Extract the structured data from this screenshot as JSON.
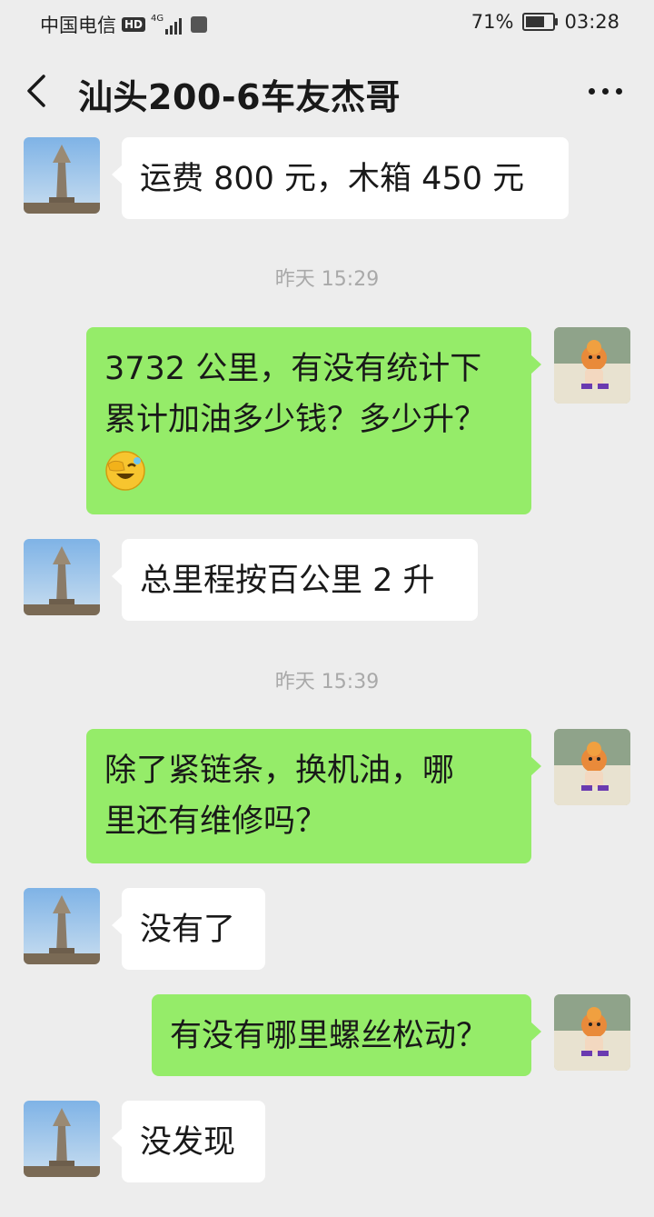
{
  "status_bar": {
    "carrier": "中国电信",
    "hd": "HD",
    "network": "4G",
    "battery_percent": "71%",
    "battery_level": 0.71,
    "time": "03:28"
  },
  "nav": {
    "back_icon": "chevron-left-icon",
    "title": "汕头200-6车友杰哥",
    "more_icon": "more-dots-icon"
  },
  "messages": [
    {
      "side": "in",
      "text": "运费 800 元，木箱 450 元"
    },
    {
      "timestamp": "昨天 15:29"
    },
    {
      "side": "out",
      "line1": "3732 公里，有没有统计下",
      "line2": "累计加油多少钱？多少升？",
      "emoji": "facepalm-laugh-emoji"
    },
    {
      "side": "in",
      "text": "总里程按百公里 2 升"
    },
    {
      "timestamp": "昨天 15:39"
    },
    {
      "side": "out",
      "line1": "除了紧链条，换机油，哪",
      "line2": "里还有维修吗？"
    },
    {
      "side": "in",
      "text": "没有了"
    },
    {
      "side": "out",
      "text": "有没有哪里螺丝松动？"
    },
    {
      "side": "in",
      "text": "没发现"
    }
  ],
  "colors": {
    "background": "#ededed",
    "incoming_bubble": "#ffffff",
    "outgoing_bubble": "#95ec69",
    "timestamp_text": "#a9a9a9"
  }
}
